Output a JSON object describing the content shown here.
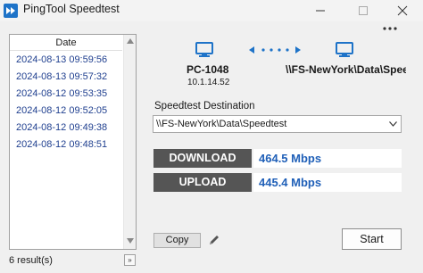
{
  "window": {
    "title": "PingTool Speedtest"
  },
  "results": {
    "column_header": "Date",
    "rows": [
      "2024-08-13 09:59:56",
      "2024-08-13 09:57:32",
      "2024-08-12 09:53:35",
      "2024-08-12 09:52:05",
      "2024-08-12 09:49:38",
      "2024-08-12 09:48:51"
    ],
    "status": "6 result(s)",
    "expand_label": "»"
  },
  "connection": {
    "source_name": "PC-1048",
    "source_ip": "10.1.14.52",
    "destination_name": "\\\\FS-NewYork\\Data\\Speedtest"
  },
  "destination": {
    "label": "Speedtest Destination",
    "selected": "\\\\FS-NewYork\\Data\\Speedtest"
  },
  "metrics": {
    "download_label": "DOWNLOAD",
    "download_value": "464.5 Mbps",
    "upload_label": "UPLOAD",
    "upload_value": "445.4 Mbps"
  },
  "actions": {
    "copy_label": "Copy",
    "start_label": "Start"
  },
  "colors": {
    "accent": "#2060b8",
    "monitor_blue": "#1e73c8",
    "metric_label_bg": "#555555"
  }
}
